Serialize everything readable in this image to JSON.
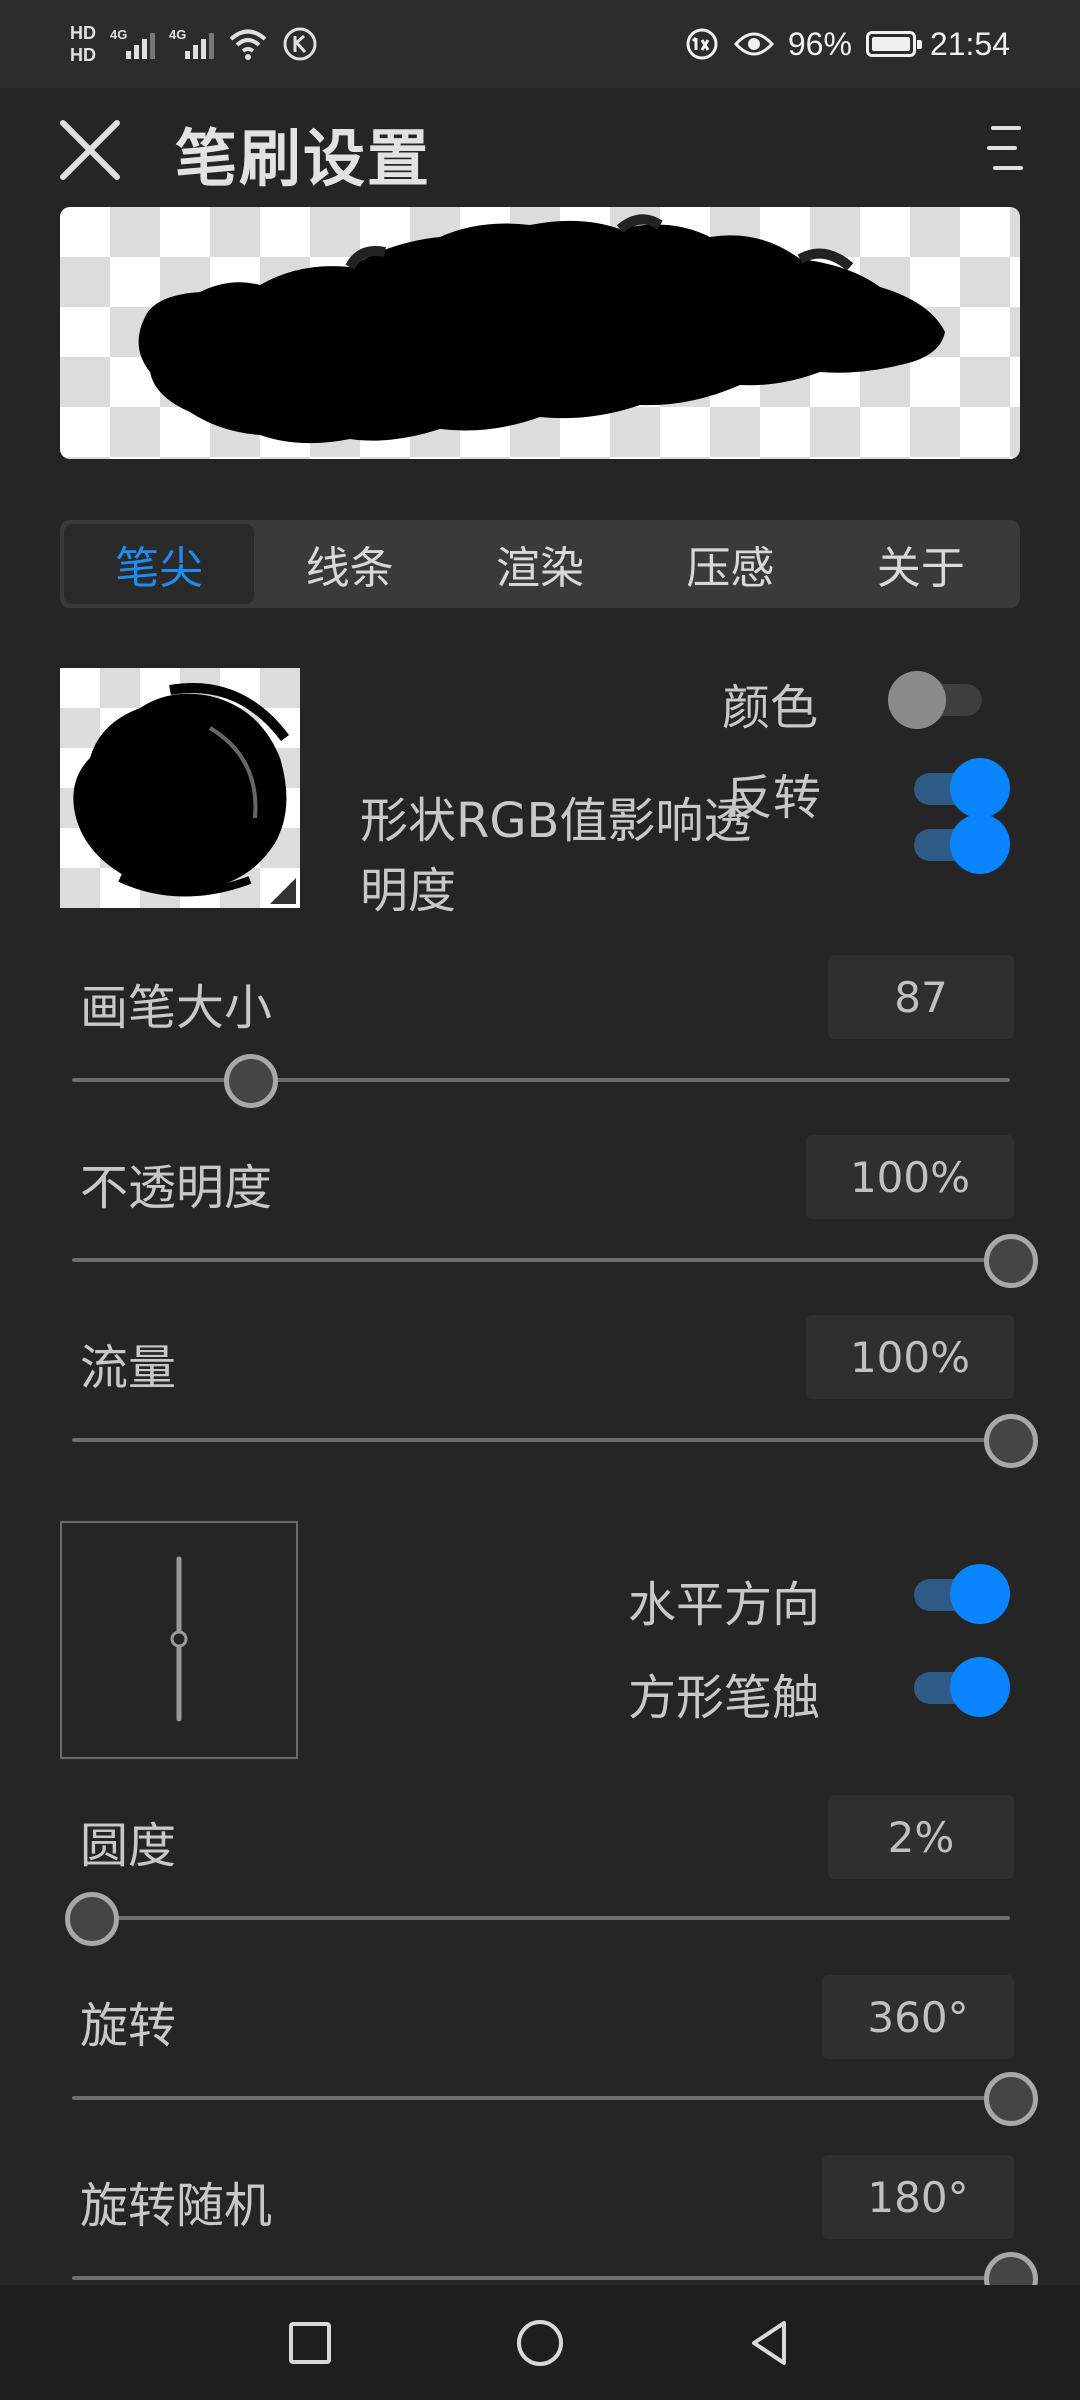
{
  "status_bar": {
    "hd1": "HD",
    "hd2": "HD",
    "net1": "4G",
    "net2": "4G",
    "battery_percent": "96%",
    "time": "21:54"
  },
  "header": {
    "title": "笔刷设置",
    "close_icon": "close-icon",
    "menu_icon": "menu-icon"
  },
  "tabs": [
    {
      "label": "笔尖",
      "active": true
    },
    {
      "label": "线条",
      "active": false
    },
    {
      "label": "渲染",
      "active": false
    },
    {
      "label": "压感",
      "active": false
    },
    {
      "label": "关于",
      "active": false
    }
  ],
  "tip_options": {
    "color_label": "颜色",
    "color_on": false,
    "invert_label": "反转",
    "invert_on": true,
    "rgb_alpha_label": "形状RGB值影响透明度",
    "rgb_alpha_line1": "形状RGB值影响透",
    "rgb_alpha_line2": "明度",
    "rgb_alpha_on": true
  },
  "sliders": {
    "size": {
      "label": "画笔大小",
      "value": "87",
      "position": 0.19
    },
    "opacity": {
      "label": "不透明度",
      "value": "100%",
      "position": 1.0
    },
    "flow": {
      "label": "流量",
      "value": "100%",
      "position": 1.0
    },
    "roundness": {
      "label": "圆度",
      "value": "2%",
      "position": 0.02
    },
    "rotation": {
      "label": "旋转",
      "value": "360°",
      "position": 1.0
    },
    "rotation_random": {
      "label": "旋转随机",
      "value": "180°",
      "position": 1.0
    }
  },
  "shape_options": {
    "horizontal_label": "水平方向",
    "horizontal_on": true,
    "square_label": "方形笔触",
    "square_on": true
  },
  "colors": {
    "accent": "#0a84ff",
    "background": "#252525"
  }
}
